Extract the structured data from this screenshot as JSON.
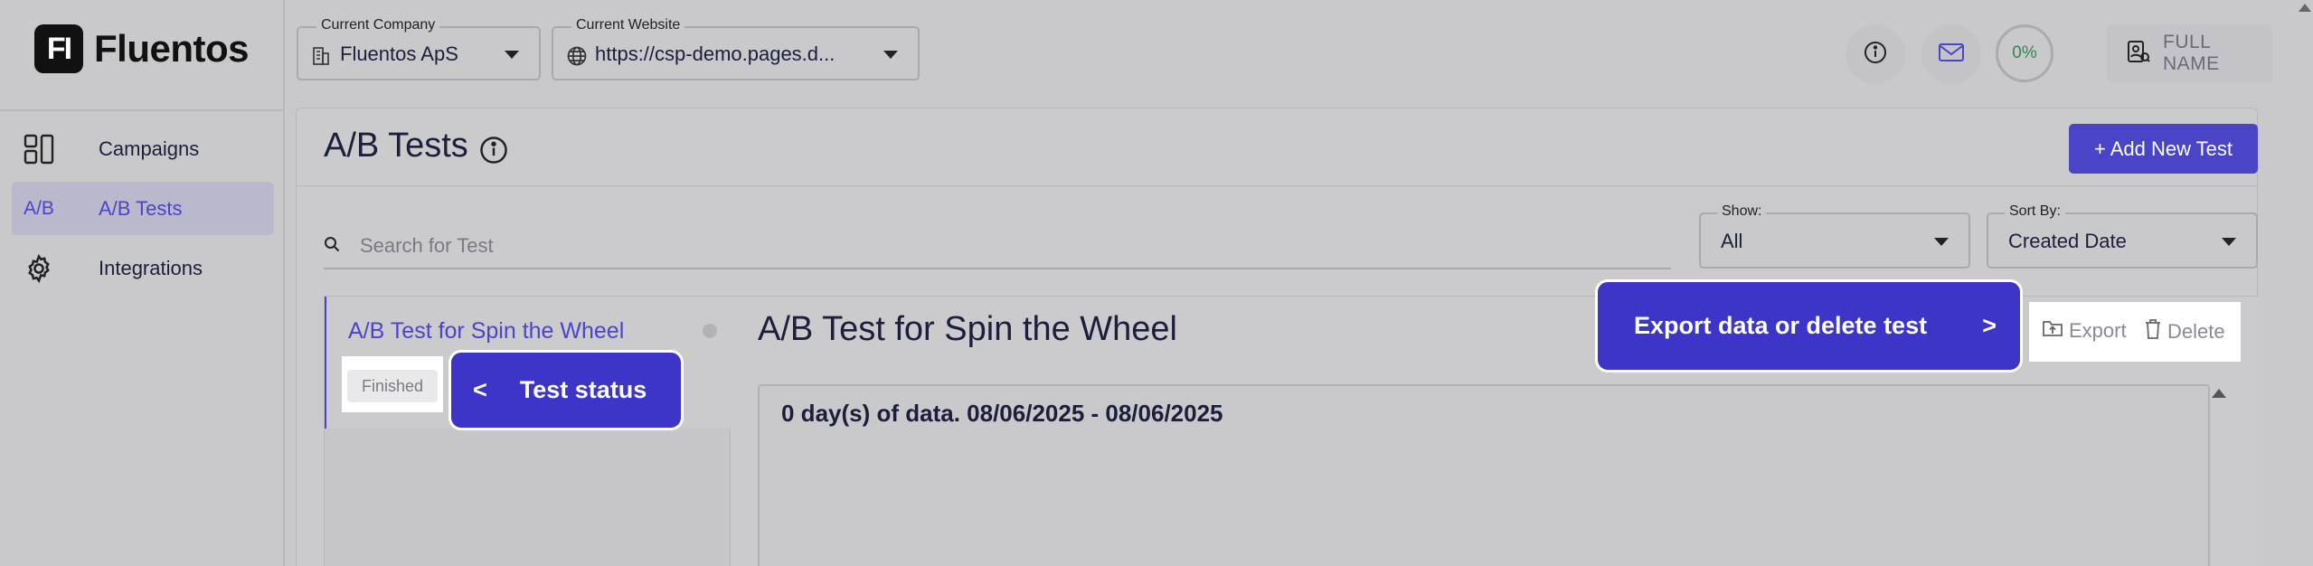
{
  "brand": {
    "logo_mark": "FI",
    "name": "Fluentos"
  },
  "sidebar": {
    "items": [
      {
        "label": "Campaigns",
        "icon": "campaigns-icon",
        "active": false
      },
      {
        "label": "A/B Tests",
        "icon_text": "A/B",
        "active": true
      },
      {
        "label": "Integrations",
        "icon": "gear-icon",
        "active": false
      }
    ]
  },
  "topbar": {
    "company": {
      "label": "Current Company",
      "value": "Fluentos ApS"
    },
    "website": {
      "label": "Current Website",
      "value": "https://csp-demo.pages.d..."
    },
    "progress": "0%",
    "user_name": "FULL NAME"
  },
  "page": {
    "title": "A/B Tests",
    "add_button": "+ Add New Test",
    "search_placeholder": "Search for Test",
    "show": {
      "label": "Show:",
      "value": "All"
    },
    "sort": {
      "label": "Sort By:",
      "value": "Created Date"
    }
  },
  "tests": [
    {
      "name": "A/B Test for Spin the Wheel",
      "status": "Finished"
    }
  ],
  "detail": {
    "title": "A/B Test for Spin the Wheel",
    "export_label": "Export",
    "delete_label": "Delete",
    "data_summary": "0 day(s) of data. 08/06/2025 - 08/06/2025"
  },
  "tour": {
    "status_callout": {
      "arrow": "<",
      "text": "Test status"
    },
    "actions_callout": {
      "text": "Export data or delete test",
      "arrow": ">"
    }
  },
  "colors": {
    "accent": "#4a44c6",
    "callout": "#3c35c8",
    "progress_text": "#2d8a4a"
  }
}
